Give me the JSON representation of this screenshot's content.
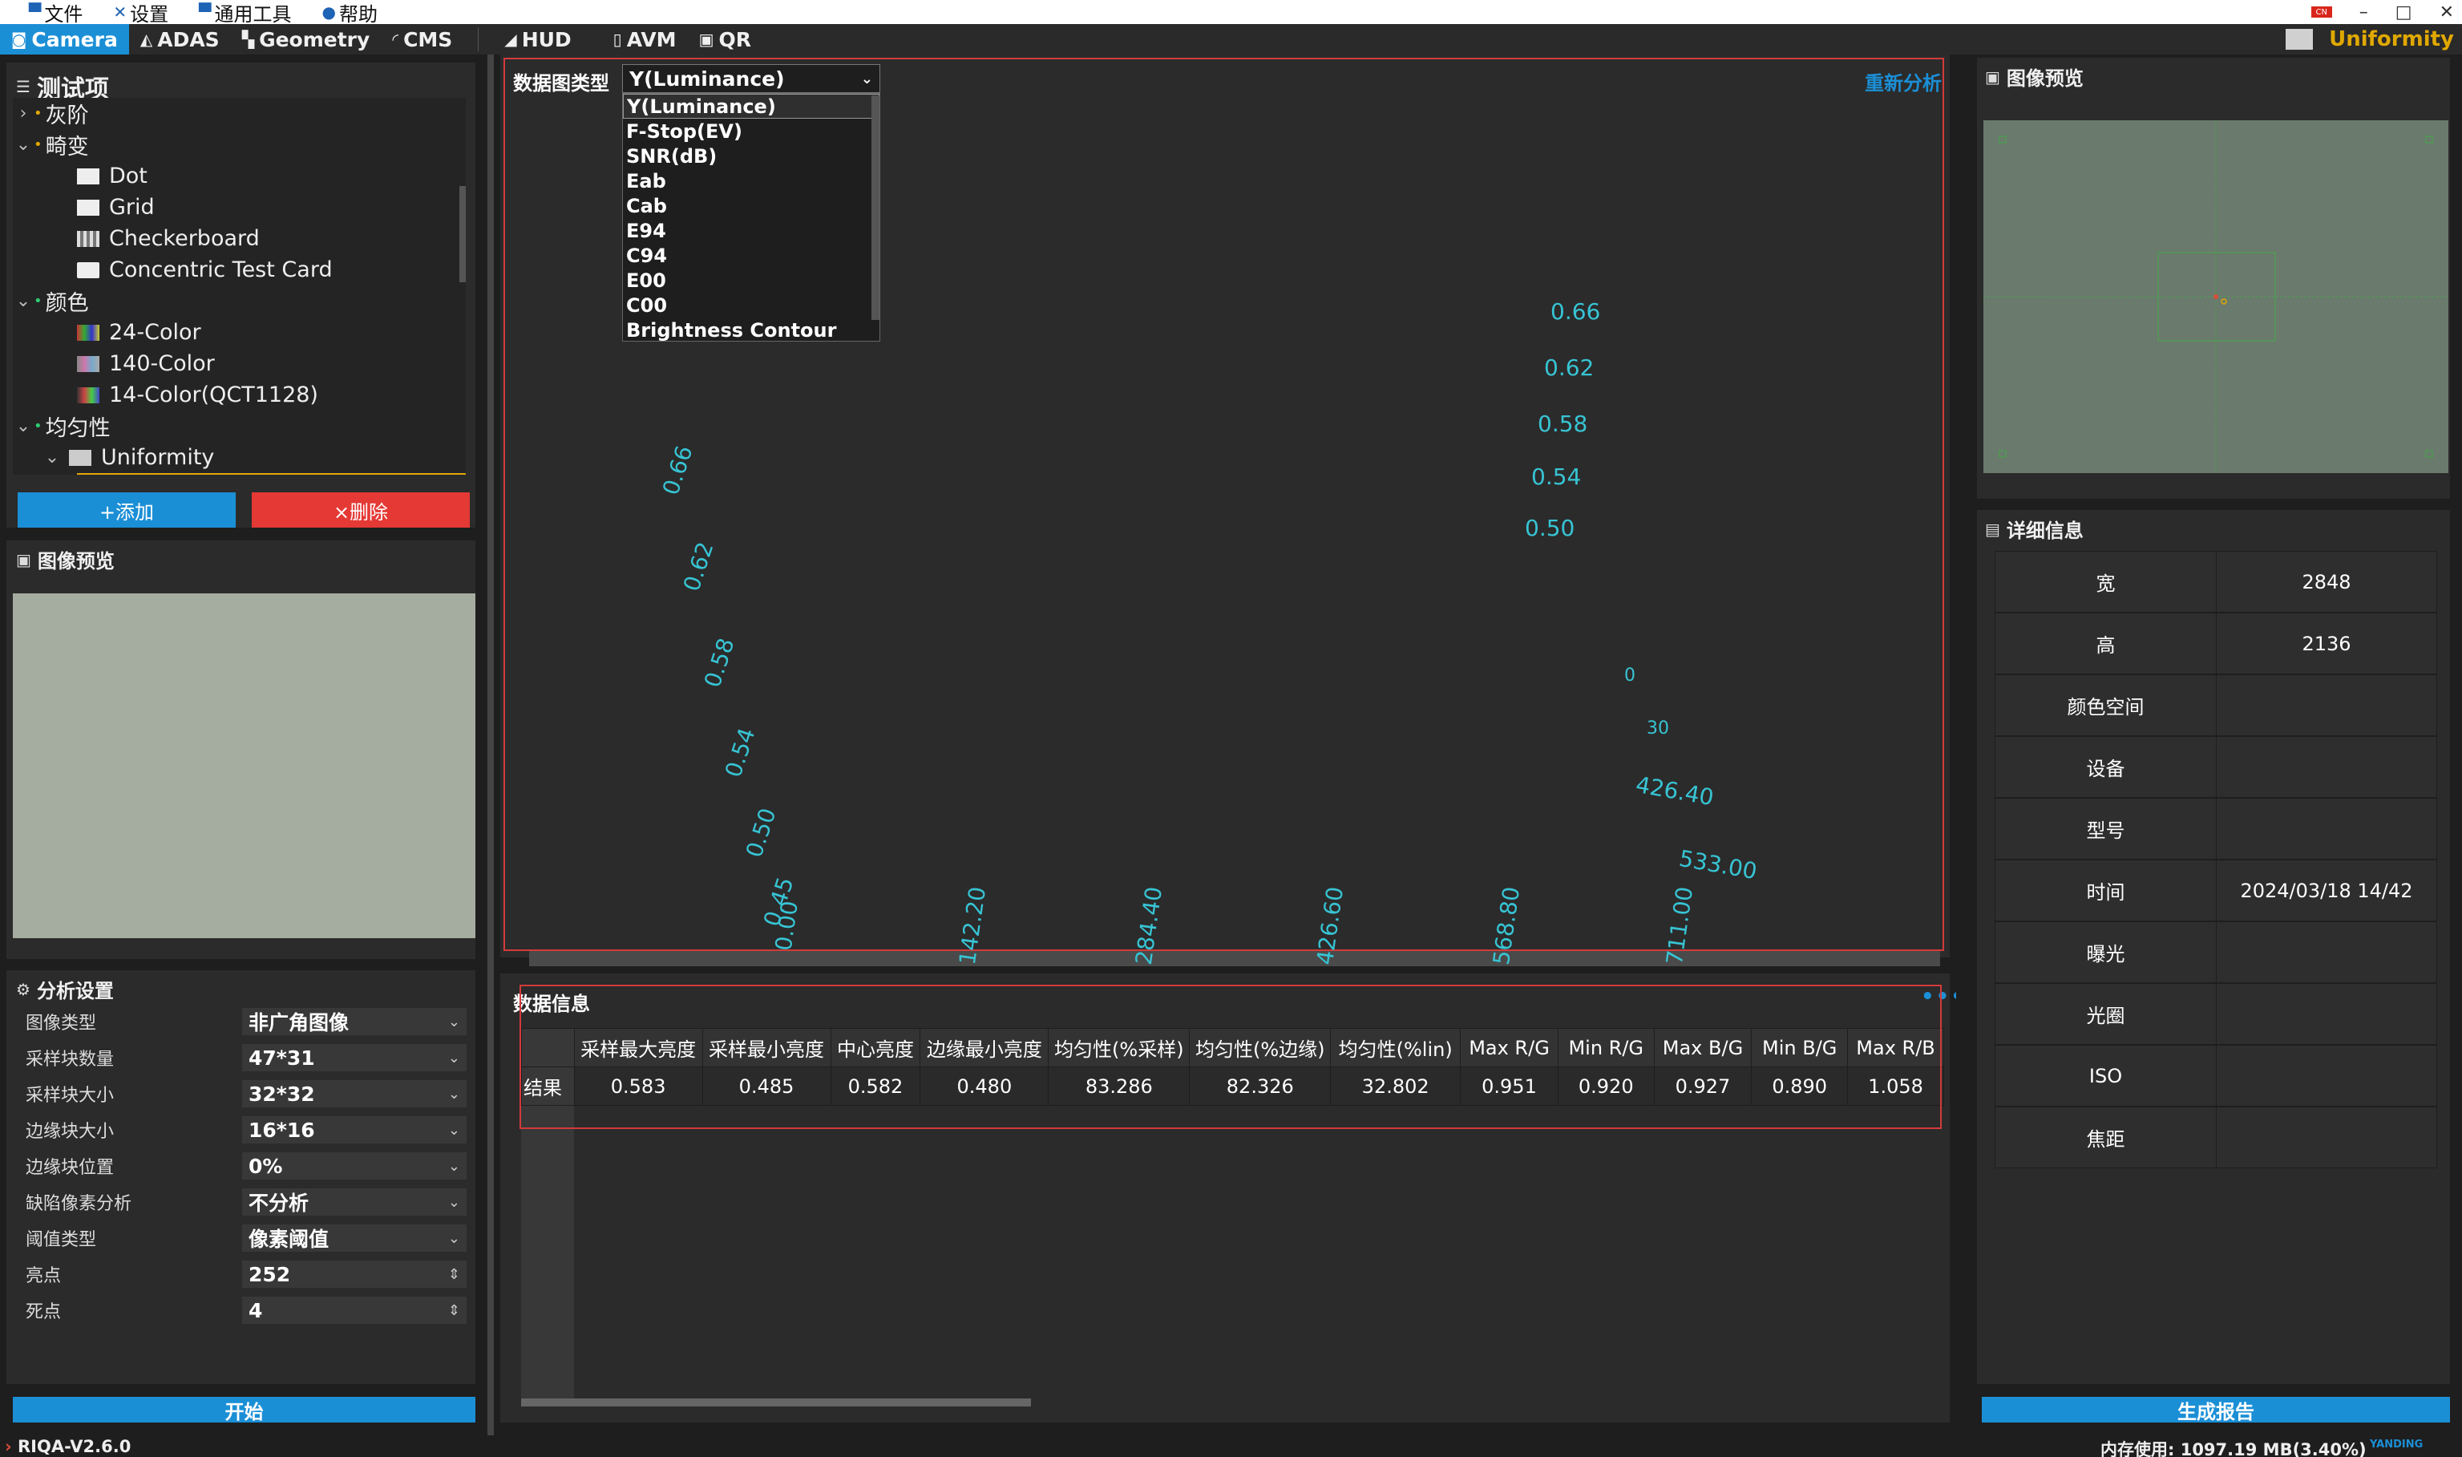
{
  "menu": {
    "file": "文件",
    "settings": "设置",
    "tools": "通用工具",
    "help": "帮助"
  },
  "window": {
    "lang_badge": "CN",
    "minimize": "–",
    "maximize": "□",
    "close": "✕"
  },
  "tabs": {
    "camera": "Camera",
    "adas": "ADAS",
    "geometry": "Geometry",
    "cms": "CMS",
    "hud": "HUD",
    "avm": "AVM",
    "qr": "QR"
  },
  "current_test": "Uniformity",
  "test_items": {
    "title": "测试项",
    "gray": "灰阶",
    "distortion": "畸变",
    "dot": "Dot",
    "grid": "Grid",
    "checkerboard": "Checkerboard",
    "concentric": "Concentric Test Card",
    "color": "颜色",
    "c24": "24-Color",
    "c140": "140-Color",
    "c14": "14-Color(QCT1128)",
    "uniformity_group": "均匀性",
    "uniformity": "Uniformity"
  },
  "buttons": {
    "add": "+添加",
    "delete": "×删除",
    "start": "开始",
    "report": "生成报告"
  },
  "preview_title": "图像预览",
  "analysis": {
    "title": "分析设置",
    "rows": [
      {
        "label": "图像类型",
        "value": "非广角图像"
      },
      {
        "label": "采样块数量",
        "value": "47*31"
      },
      {
        "label": "采样块大小",
        "value": "32*32"
      },
      {
        "label": "边缘块大小",
        "value": "16*16"
      },
      {
        "label": "边缘块位置",
        "value": "0%"
      },
      {
        "label": "缺陷像素分析",
        "value": "不分析"
      },
      {
        "label": "阈值类型",
        "value": "像素阈值"
      },
      {
        "label": "亮点",
        "value": "252"
      },
      {
        "label": "死点",
        "value": "4"
      }
    ]
  },
  "chart": {
    "dtype_label": "数据图类型",
    "dtype_selected": "Y(Luminance)",
    "dtype_options": [
      "Y(Luminance)",
      "F-Stop(EV)",
      "SNR(dB)",
      "Eab",
      "Cab",
      "E94",
      "C94",
      "E00",
      "C00",
      "Brightness Contour"
    ],
    "reanalyze": "重新分析",
    "z_ticks_right": [
      "0.66",
      "0.62",
      "0.58",
      "0.54",
      "0.50"
    ],
    "z_ticks_left": [
      "0.66",
      "0.62",
      "0.58",
      "0.54",
      "0.50",
      "0.45"
    ],
    "x_ticks": [
      "0.00",
      "142.20",
      "284.40",
      "426.60",
      "568.80",
      "711.00"
    ],
    "y_ticks": [
      "426.40",
      "533.00"
    ],
    "partial_labels": [
      "0",
      "30"
    ]
  },
  "data_info": {
    "title": "数据信息",
    "more": "•••",
    "headers": [
      "采样最大亮度",
      "采样最小亮度",
      "中心亮度",
      "边缘最小亮度",
      "均匀性(%采样)",
      "均匀性(%边缘)",
      "均匀性(%lin)",
      "Max R/G",
      "Min R/G",
      "Max B/G",
      "Min B/G",
      "Max R/B"
    ],
    "row_label": "结果",
    "values": [
      "0.583",
      "0.485",
      "0.582",
      "0.480",
      "83.286",
      "82.326",
      "32.802",
      "0.951",
      "0.920",
      "0.927",
      "0.890",
      "1.058"
    ]
  },
  "details": {
    "title": "详细信息",
    "rows": [
      {
        "k": "宽",
        "v": "2848"
      },
      {
        "k": "高",
        "v": "2136"
      },
      {
        "k": "颜色空间",
        "v": ""
      },
      {
        "k": "设备",
        "v": ""
      },
      {
        "k": "型号",
        "v": ""
      },
      {
        "k": "时间",
        "v": "2024/03/18 14/42"
      },
      {
        "k": "曝光",
        "v": ""
      },
      {
        "k": "光圈",
        "v": ""
      },
      {
        "k": "ISO",
        "v": ""
      },
      {
        "k": "焦距",
        "v": ""
      }
    ]
  },
  "status": {
    "version": "RIQA-V2.6.0",
    "memory": "内存使用: 1097.19 MB(3.40%)",
    "brand": "YANDING"
  },
  "colors": {
    "accent": "#1b8fd6",
    "delete": "#e53935",
    "highlight": "#e0a800",
    "axis": "#37c4d4",
    "redbox": "#d43a3a"
  }
}
